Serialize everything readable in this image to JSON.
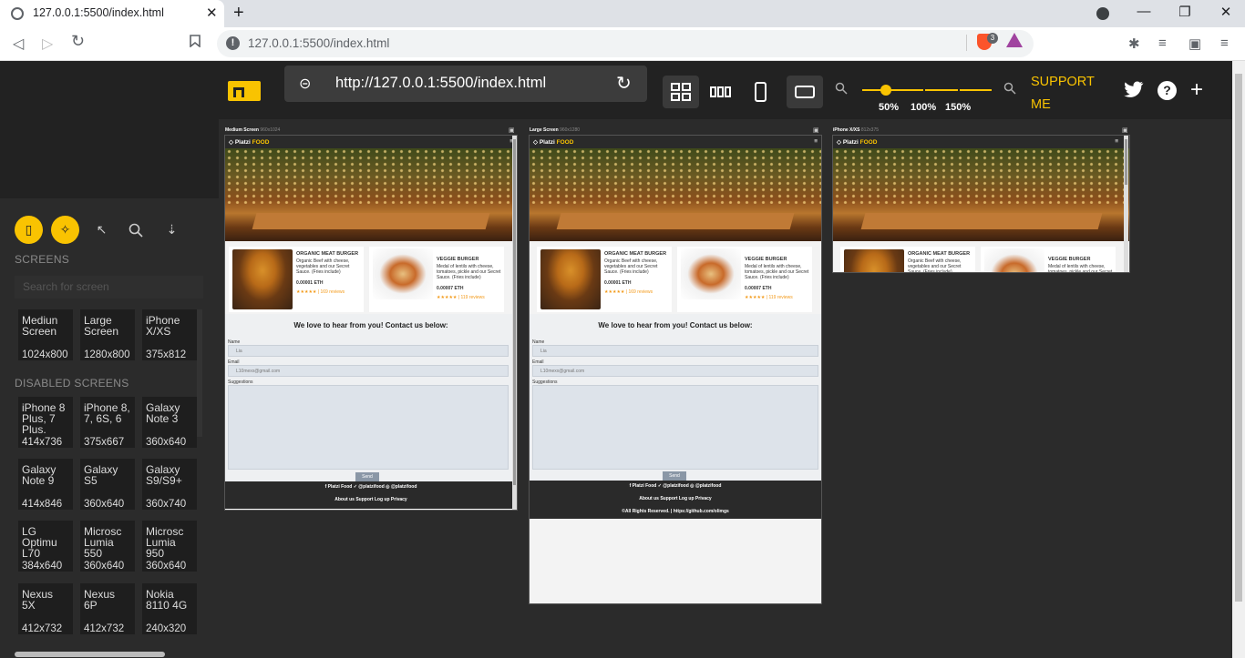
{
  "browser": {
    "tab_title": "127.0.0.1:5500/index.html",
    "close_glyph": "✕",
    "new_tab_glyph": "+",
    "address": "127.0.0.1:5500/index.html",
    "info_glyph": "!",
    "brave_badge": "3",
    "back_glyph": "◁",
    "forward_glyph": "▷",
    "reload_glyph": "↻",
    "bookmark_glyph": "🔖",
    "win_minimize": "—",
    "win_restore": "❐",
    "win_close": "✕",
    "extensions_glyph": "✱",
    "media_glyph": "≡",
    "wallet_glyph": "▣",
    "menu_glyph": "≡",
    "profile_glyph": "●"
  },
  "app": {
    "url": "http://127.0.0.1:5500/index.html",
    "link_glyph": "⊝",
    "reload_glyph": "↻",
    "zoom_out_glyph": "🔍",
    "zoom_in_glyph": "🔍",
    "zoom_labels": [
      "50%",
      "100%",
      "150%"
    ],
    "zoom_level": 0.18,
    "support_label": "SUPPORT ME",
    "twitter_glyph": "🐦",
    "help_glyph": "?",
    "add_glyph": "+",
    "accent": "#f9c301"
  },
  "sidebar": {
    "tools": [
      {
        "name": "device-tool",
        "glyph": "▯"
      },
      {
        "name": "click-sync-tool",
        "glyph": "✧"
      },
      {
        "name": "cursor-tool",
        "glyph": "↖"
      },
      {
        "name": "search-tool",
        "glyph": "○"
      },
      {
        "name": "download-tool",
        "glyph": "⇣"
      }
    ],
    "screens_heading": "SCREENS",
    "search_placeholder": "Search for screen",
    "screens": [
      {
        "name": "Mediun Screen",
        "dim": "1024x800"
      },
      {
        "name": "Large Screen",
        "dim": "1280x800"
      },
      {
        "name": "iPhone X/XS",
        "dim": "375x812"
      }
    ],
    "disabled_heading": "DISABLED SCREENS",
    "disabled": [
      {
        "name": "iPhone 8 Plus, 7 Plus,",
        "dim": "414x736"
      },
      {
        "name": "iPhone 8, 7, 6S, 6",
        "dim": "375x667"
      },
      {
        "name": "Galaxy Note 3",
        "dim": "360x640"
      },
      {
        "name": "Galaxy Note 9",
        "dim": "414x846"
      },
      {
        "name": "Galaxy S5",
        "dim": "360x640"
      },
      {
        "name": "Galaxy S9/S9+",
        "dim": "360x740"
      },
      {
        "name": "LG Optimu L70",
        "dim": "384x640"
      },
      {
        "name": "Microsc Lumia 550",
        "dim": "360x640"
      },
      {
        "name": "Microsc Lumia 950",
        "dim": "360x640"
      },
      {
        "name": "Nexus 5X",
        "dim": "412x732"
      },
      {
        "name": "Nexus 6P",
        "dim": "412x732"
      },
      {
        "name": "Nokia 8110 4G",
        "dim": "240x320"
      }
    ]
  },
  "frames": [
    {
      "label": "Medium Screen",
      "dim": "960x1024"
    },
    {
      "label": "Large Screen",
      "dim": "960x1280"
    },
    {
      "label": "iPhone X/XS",
      "dim": "812x375"
    }
  ],
  "site": {
    "brand_a": "Platzi ",
    "brand_b": "FOOD",
    "menu_glyph": "≡",
    "products": [
      {
        "name": "ORGANIC MEAT BURGER",
        "desc": "Organic Beef with cheese, vegetables and our Secret Sauce. (Fries include)",
        "price": "0.00001 ETH",
        "rating": "★★★★★ | 169 reviews"
      },
      {
        "name": "VEGGIE BURGER",
        "desc": "Medal of lentils with cheese, tomatoes, pickle and our Secret Sauce. (Fries include)",
        "price": "0.00007 ETH",
        "rating": "★★★★★ | 119 reviews"
      }
    ],
    "contact_heading": "We love to hear from you! Contact us below:",
    "name_label": "Name",
    "name_value": "Lia",
    "email_label": "Email",
    "email_value": "L10mexx@gmail.com",
    "suggestions_label": "Suggestions",
    "send_label": "Send",
    "social": "f Platzi Food   ✓ @platzifood   ◎ @platzifood",
    "footer_links": "About us    Support    Log up    Privacy",
    "copyright": "©All Rights Reserved. | https://github.com/olimgs"
  }
}
